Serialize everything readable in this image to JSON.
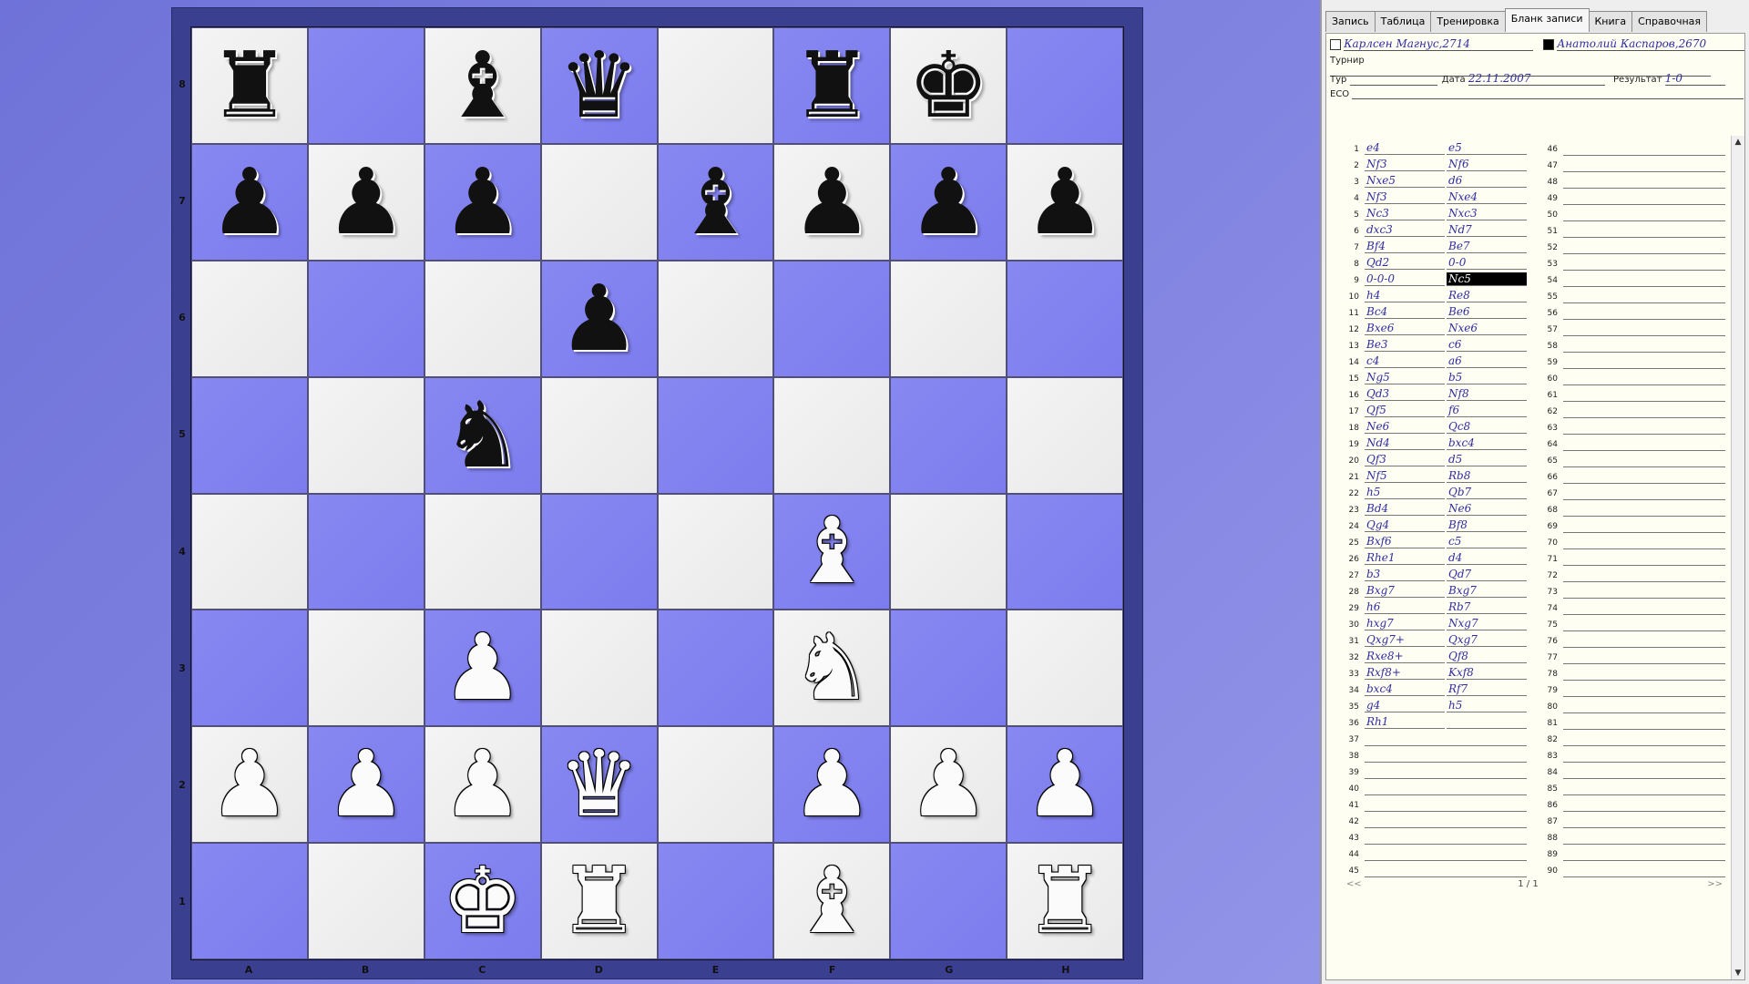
{
  "board": {
    "files": [
      "A",
      "B",
      "C",
      "D",
      "E",
      "F",
      "G",
      "H"
    ],
    "ranks": [
      "8",
      "7",
      "6",
      "5",
      "4",
      "3",
      "2",
      "1"
    ],
    "position": [
      [
        "bR",
        "",
        "bB",
        "bQ",
        "",
        "bR",
        "bK",
        ""
      ],
      [
        "bP",
        "bP",
        "bP",
        "",
        "bB",
        "bP",
        "bP",
        "bP"
      ],
      [
        "",
        "",
        "",
        "bP",
        "",
        "",
        "",
        ""
      ],
      [
        "",
        "",
        "bN",
        "",
        "",
        "",
        "",
        ""
      ],
      [
        "",
        "",
        "",
        "",
        "",
        "wB",
        "",
        ""
      ],
      [
        "",
        "",
        "wP",
        "",
        "",
        "wN",
        "",
        ""
      ],
      [
        "wP",
        "wP",
        "wP",
        "wQ",
        "",
        "wP",
        "wP",
        "wP"
      ],
      [
        "",
        "",
        "wK",
        "wR",
        "",
        "wB",
        "",
        "wR"
      ]
    ],
    "glyphs": {
      "K": "♚",
      "Q": "♛",
      "R": "♜",
      "B": "♝",
      "N": "♞",
      "P": "♟"
    },
    "colors": {
      "light": "#ececec",
      "dark": "#8080f0",
      "frame": "#3a3f90"
    }
  },
  "panel": {
    "tabs": [
      "Запись",
      "Таблица",
      "Тренировка",
      "Бланк записи",
      "Книга",
      "Справочная"
    ],
    "active_tab": 3,
    "white_player": "Карлсен Магнус,2714",
    "black_player": "Анатолий Каспаров,2670",
    "tournament_label": "Турнир",
    "tournament_value": "",
    "round_label": "Тур",
    "round_value": "",
    "date_label": "Дата",
    "date_value": "22.11.2007",
    "result_label": "Результат",
    "result_value": "1-0",
    "eco_label": "ECO",
    "eco_value": "",
    "moves": [
      [
        "e4",
        "e5"
      ],
      [
        "Nf3",
        "Nf6"
      ],
      [
        "Nxe5",
        "d6"
      ],
      [
        "Nf3",
        "Nxe4"
      ],
      [
        "Nc3",
        "Nxc3"
      ],
      [
        "dxc3",
        "Nd7"
      ],
      [
        "Bf4",
        "Be7"
      ],
      [
        "Qd2",
        "0-0"
      ],
      [
        "0-0-0",
        "Nc5"
      ],
      [
        "h4",
        "Re8"
      ],
      [
        "Bc4",
        "Be6"
      ],
      [
        "Bxe6",
        "Nxe6"
      ],
      [
        "Be3",
        "c6"
      ],
      [
        "c4",
        "a6"
      ],
      [
        "Ng5",
        "b5"
      ],
      [
        "Qd3",
        "Nf8"
      ],
      [
        "Qf5",
        "f6"
      ],
      [
        "Ne6",
        "Qc8"
      ],
      [
        "Nd4",
        "bxc4"
      ],
      [
        "Qf3",
        "d5"
      ],
      [
        "Nf5",
        "Rb8"
      ],
      [
        "h5",
        "Qb7"
      ],
      [
        "Bd4",
        "Ne6"
      ],
      [
        "Qg4",
        "Bf8"
      ],
      [
        "Bxf6",
        "c5"
      ],
      [
        "Rhe1",
        "d4"
      ],
      [
        "b3",
        "Qd7"
      ],
      [
        "Bxg7",
        "Bxg7"
      ],
      [
        "h6",
        "Rb7"
      ],
      [
        "hxg7",
        "Nxg7"
      ],
      [
        "Qxg7+",
        "Qxg7"
      ],
      [
        "Rxe8+",
        "Qf8"
      ],
      [
        "Rxf8+",
        "Kxf8"
      ],
      [
        "bxc4",
        "Rf7"
      ],
      [
        "g4",
        "h5"
      ],
      [
        "Rh1",
        ""
      ]
    ],
    "selected_move": {
      "index": 8,
      "side": "b"
    },
    "total_rows": 90,
    "rows_per_column": 45,
    "pager_prev": "<<",
    "pager_text": "1 / 1",
    "pager_next": ">>"
  }
}
